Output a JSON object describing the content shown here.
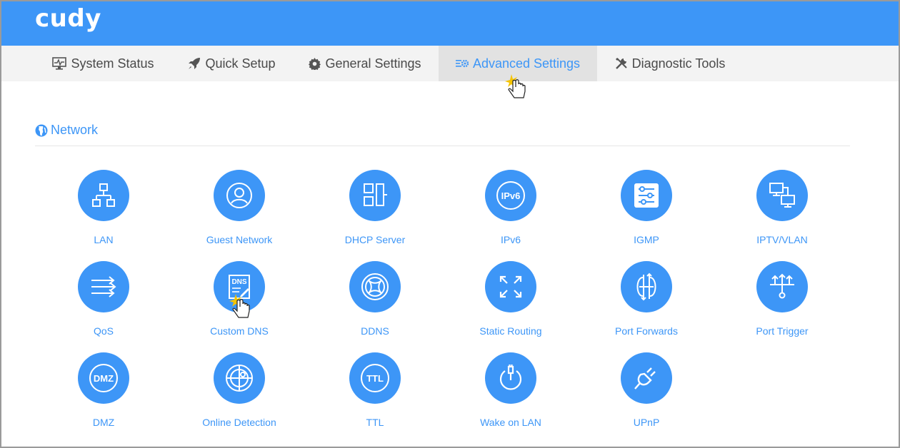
{
  "brand": {
    "logo_text": "cudy",
    "accent": "#3d96f7"
  },
  "nav": {
    "tabs": [
      {
        "label": "System Status",
        "icon": "monitor-pulse-icon"
      },
      {
        "label": "Quick Setup",
        "icon": "rocket-icon"
      },
      {
        "label": "General Settings",
        "icon": "gear-icon"
      },
      {
        "label": "Advanced Settings",
        "icon": "sliders-gear-icon",
        "active": true
      },
      {
        "label": "Diagnostic Tools",
        "icon": "tools-icon"
      }
    ]
  },
  "section": {
    "title": "Network",
    "icon": "globe-icon"
  },
  "tiles": [
    {
      "label": "LAN",
      "icon": "lan-icon"
    },
    {
      "label": "Guest Network",
      "icon": "guest-user-icon"
    },
    {
      "label": "DHCP Server",
      "icon": "dhcp-icon"
    },
    {
      "label": "IPv6",
      "icon": "ipv6-icon"
    },
    {
      "label": "IGMP",
      "icon": "igmp-sliders-icon"
    },
    {
      "label": "IPTV/VLAN",
      "icon": "iptv-monitors-icon"
    },
    {
      "label": "QoS",
      "icon": "qos-arrows-icon"
    },
    {
      "label": "Custom DNS",
      "icon": "dns-icon"
    },
    {
      "label": "DDNS",
      "icon": "ddns-globe-icon"
    },
    {
      "label": "Static Routing",
      "icon": "routing-arrows-icon"
    },
    {
      "label": "Port Forwards",
      "icon": "port-forward-icon"
    },
    {
      "label": "Port Trigger",
      "icon": "port-trigger-icon"
    },
    {
      "label": "DMZ",
      "icon": "dmz-icon"
    },
    {
      "label": "Online Detection",
      "icon": "online-detection-icon"
    },
    {
      "label": "TTL",
      "icon": "ttl-icon"
    },
    {
      "label": "Wake on LAN",
      "icon": "power-plug-icon"
    },
    {
      "label": "UPnP",
      "icon": "plug-icon"
    }
  ],
  "icon_text": {
    "ipv6": "IPv6",
    "dns": "DNS",
    "dmz": "DMZ",
    "ttl": "TTL"
  }
}
